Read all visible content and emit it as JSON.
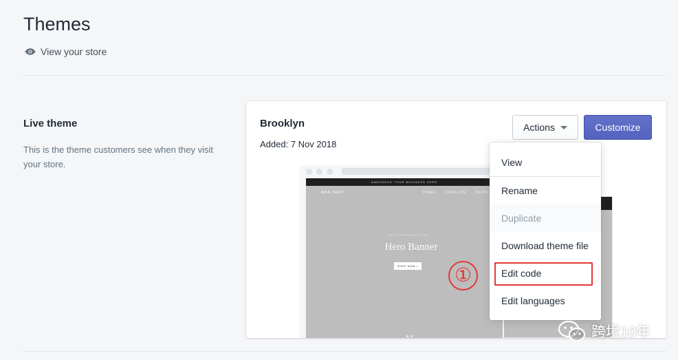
{
  "page": {
    "title": "Themes",
    "view_store": "View your store"
  },
  "live_theme": {
    "heading": "Live theme",
    "description": "This is the theme customers see when they visit your store."
  },
  "theme_card": {
    "name": "Brooklyn",
    "added": "Added: 7 Nov 2018",
    "actions_label": "Actions",
    "customize_label": "Customize"
  },
  "preview": {
    "announcement": "ANNOUNCE YOUR BUSINESS HERE",
    "logo": "SHA-TEST",
    "nav_links": [
      "HOME",
      "CATALOG",
      "BLOG"
    ],
    "hero_subtitle": "AN INTRODUCTION",
    "hero_title": "Hero Banner",
    "hero_button": "SHOP NOW >"
  },
  "actions_menu": {
    "items": [
      {
        "label": "View",
        "disabled": false
      },
      {
        "label": "Rename",
        "disabled": false
      },
      {
        "label": "Duplicate",
        "disabled": true
      },
      {
        "label": "Download theme file",
        "disabled": false
      },
      {
        "label": "Edit code",
        "disabled": false,
        "highlighted": true
      },
      {
        "label": "Edit languages",
        "disabled": false
      }
    ]
  },
  "annotation": {
    "step_marker": "①",
    "highlight_color": "#e53935"
  },
  "watermark": {
    "text": "跨境10年"
  },
  "colors": {
    "primary_button": "#5c6ac4",
    "background": "#f4f6f8"
  }
}
